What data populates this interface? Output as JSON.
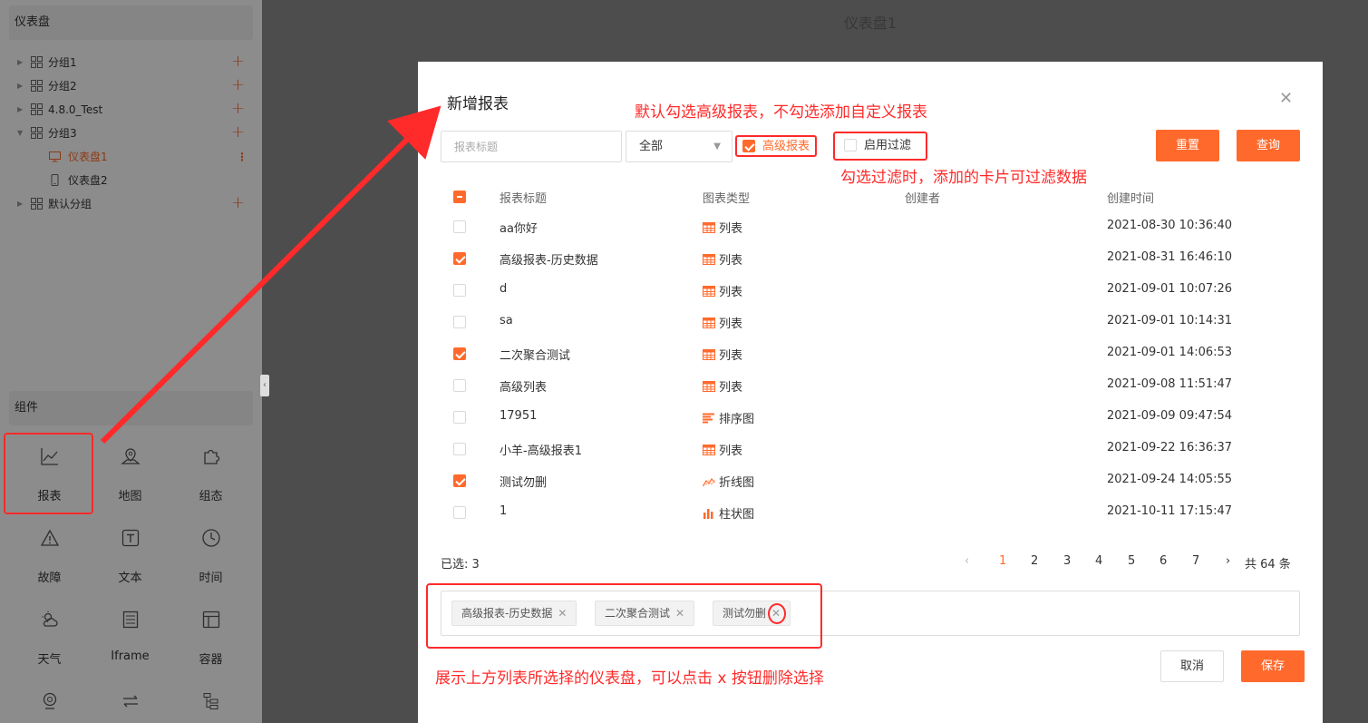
{
  "sidebar": {
    "dashboard_header": "仪表盘",
    "tree": [
      {
        "label": "分组1",
        "expanded": false
      },
      {
        "label": "分组2",
        "expanded": false
      },
      {
        "label": "4.8.0_Test",
        "expanded": false
      },
      {
        "label": "分组3",
        "expanded": true
      },
      {
        "label": "仪表盘1",
        "child": true,
        "active": true
      },
      {
        "label": "仪表盘2",
        "child": true
      },
      {
        "label": "默认分组",
        "expanded": false
      }
    ],
    "components_header": "组件",
    "components": [
      {
        "label": "报表",
        "icon": "line-chart-icon"
      },
      {
        "label": "地图",
        "icon": "map-icon"
      },
      {
        "label": "组态",
        "icon": "puzzle-icon"
      },
      {
        "label": "故障",
        "icon": "warning-icon"
      },
      {
        "label": "文本",
        "icon": "text-icon"
      },
      {
        "label": "时间",
        "icon": "clock-icon"
      },
      {
        "label": "天气",
        "icon": "weather-icon"
      },
      {
        "label": "Iframe",
        "icon": "iframe-icon"
      },
      {
        "label": "容器",
        "icon": "container-icon"
      }
    ]
  },
  "canvas": {
    "title": "仪表盘1"
  },
  "modal": {
    "title": "新增报表",
    "search_placeholder": "报表标题",
    "select_value": "全部",
    "advanced_label": "高级报表",
    "filter_label": "启用过滤",
    "reset_label": "重置",
    "query_label": "查询",
    "columns": [
      "报表标题",
      "图表类型",
      "创建者",
      "创建时间"
    ],
    "rows": [
      {
        "title": "aa你好",
        "type": "列表",
        "type_icon": "list-icon",
        "creator": "",
        "time": "2021-08-30 10:36:40",
        "checked": false
      },
      {
        "title": "高级报表-历史数据",
        "type": "列表",
        "type_icon": "list-icon",
        "creator": "",
        "time": "2021-08-31 16:46:10",
        "checked": true
      },
      {
        "title": "d",
        "type": "列表",
        "type_icon": "list-icon",
        "creator": "",
        "time": "2021-09-01 10:07:26",
        "checked": false
      },
      {
        "title": "sa",
        "type": "列表",
        "type_icon": "list-icon",
        "creator": "",
        "time": "2021-09-01 10:14:31",
        "checked": false
      },
      {
        "title": "二次聚合测试",
        "type": "列表",
        "type_icon": "list-icon",
        "creator": "",
        "time": "2021-09-01 14:06:53",
        "checked": true
      },
      {
        "title": "高级列表",
        "type": "列表",
        "type_icon": "list-icon",
        "creator": "",
        "time": "2021-09-08 11:51:47",
        "checked": false
      },
      {
        "title": "17951",
        "type": "排序图",
        "type_icon": "rank-chart-icon",
        "creator": "",
        "time": "2021-09-09 09:47:54",
        "checked": false
      },
      {
        "title": "小羊-高级报表1",
        "type": "列表",
        "type_icon": "list-icon",
        "creator": "",
        "time": "2021-09-22 16:36:37",
        "checked": false
      },
      {
        "title": "测试勿删",
        "type": "折线图",
        "type_icon": "line-chart-icon",
        "creator": "",
        "time": "2021-09-24 14:05:55",
        "checked": true
      },
      {
        "title": "1",
        "type": "柱状图",
        "type_icon": "bar-chart-icon",
        "creator": "",
        "time": "2021-10-11 17:15:47",
        "checked": false
      }
    ],
    "selected_count": "已选: 3",
    "pagination": {
      "pages": [
        "1",
        "2",
        "3",
        "4",
        "5",
        "6",
        "7"
      ],
      "current": "1",
      "total": "共 64 条"
    },
    "selected_tags": [
      "高级报表-历史数据",
      "二次聚合测试",
      "测试勿删"
    ],
    "cancel_label": "取消",
    "save_label": "保存"
  },
  "annotations": {
    "advanced_note": "默认勾选高级报表，不勾选添加自定义报表",
    "filter_note": "勾选过滤时，添加的卡片可过滤数据",
    "tags_note": "展示上方列表所选择的仪表盘，可以点击 x 按钮删除选择"
  },
  "colors": {
    "accent": "#ff6a2c",
    "annotation": "#ff2a2a"
  }
}
